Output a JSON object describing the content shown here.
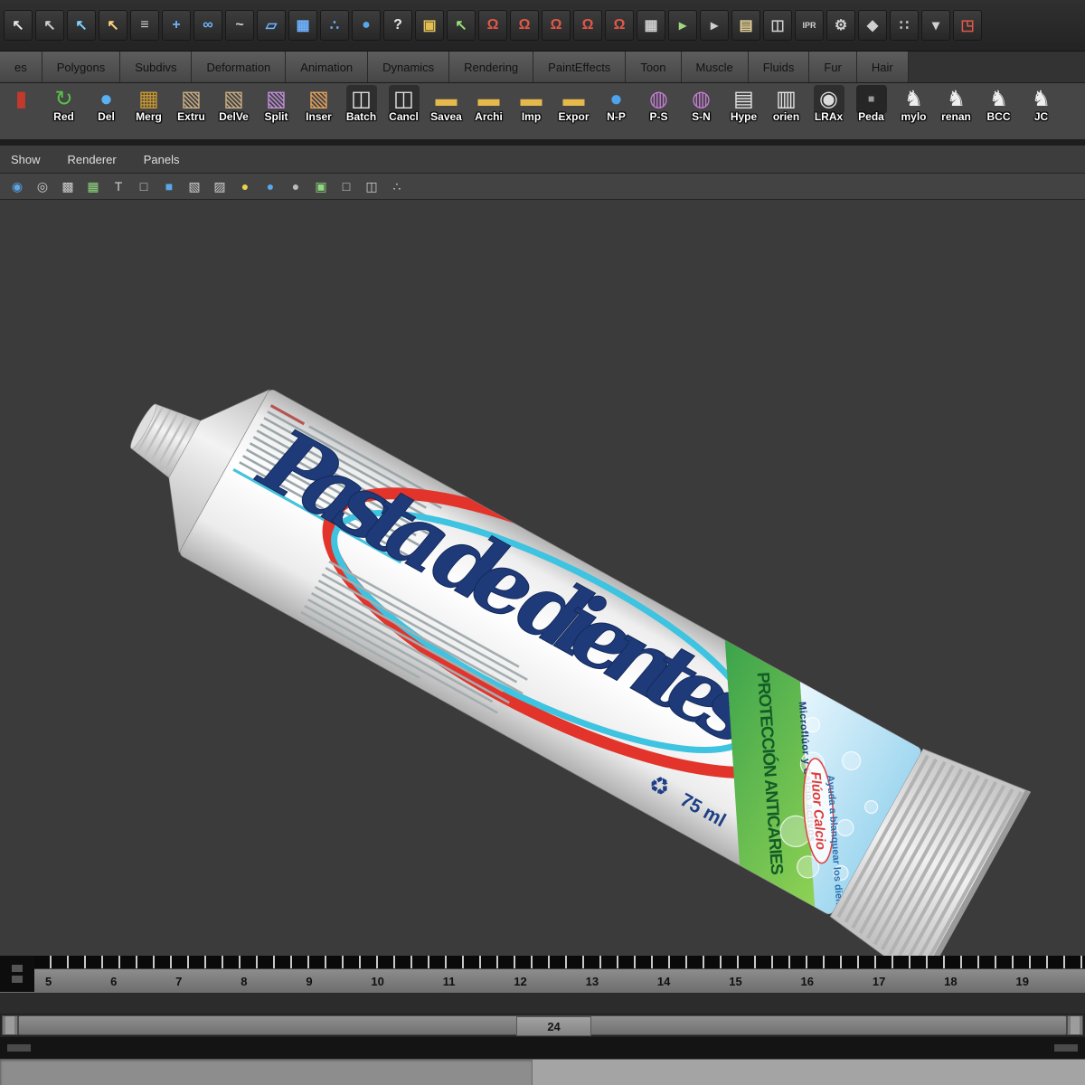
{
  "status_line": {
    "icons": [
      {
        "name": "select-tool-icon",
        "g": "↖",
        "c": "#e6e6e6"
      },
      {
        "name": "lasso-tool-icon",
        "g": "↖",
        "c": "#cfcfcf"
      },
      {
        "name": "paint-select-tool-icon",
        "g": "↖",
        "c": "#7fd4ff"
      },
      {
        "name": "select-mask-icon",
        "g": "↖",
        "c": "#ffd27f"
      },
      {
        "name": "snap-menu-icon",
        "g": "≡",
        "c": "#cfcfcf"
      },
      {
        "name": "move-tool-icon",
        "g": "+",
        "c": "#6fb3ff"
      },
      {
        "name": "rotate-tool-icon",
        "g": "∞",
        "c": "#6fb3ff"
      },
      {
        "name": "curve-target-icon",
        "g": "~",
        "c": "#cfcfcf"
      },
      {
        "name": "plane-target-icon",
        "g": "▱",
        "c": "#6fb3ff"
      },
      {
        "name": "lattice-target-icon",
        "g": "▦",
        "c": "#6fb3ff"
      },
      {
        "name": "points-target-icon",
        "g": "∴",
        "c": "#6fb3ff"
      },
      {
        "name": "sphere-target-icon",
        "g": "●",
        "c": "#5aa7e8"
      },
      {
        "name": "help-icon",
        "g": "?",
        "c": "#e8e8e8"
      },
      {
        "name": "lock-icon",
        "g": "▣",
        "c": "#e3bf54"
      },
      {
        "name": "selection-box-icon",
        "g": "↖",
        "c": "#97e07a"
      },
      {
        "name": "snap-to-grid-icon",
        "g": "Ω",
        "c": "#e0584a"
      },
      {
        "name": "snap-to-curve-icon",
        "g": "Ω",
        "c": "#e0584a"
      },
      {
        "name": "snap-to-point-icon",
        "g": "Ω",
        "c": "#e0584a"
      },
      {
        "name": "snap-to-projected-center-icon",
        "g": "Ω",
        "c": "#e0584a"
      },
      {
        "name": "snap-to-view-plane-icon",
        "g": "Ω",
        "c": "#e0584a"
      },
      {
        "name": "make-live-icon",
        "g": "▦",
        "c": "#cfcfcf"
      },
      {
        "name": "input-connections-icon",
        "g": "▸",
        "c": "#9fd87f"
      },
      {
        "name": "output-connections-icon",
        "g": "▸",
        "c": "#cfcfcf"
      },
      {
        "name": "construction-history-icon",
        "g": "▤",
        "c": "#e8d49a"
      },
      {
        "name": "render-view-icon",
        "g": "◫",
        "c": "#d0d0d0"
      },
      {
        "name": "ipr-render-icon",
        "g": "IPR",
        "c": "#d0d0d0",
        "fs": "9px"
      },
      {
        "name": "render-settings-icon",
        "g": "⚙",
        "c": "#d0d0d0"
      },
      {
        "name": "hypershade-icon",
        "g": "◆",
        "c": "#d0d0d0"
      },
      {
        "name": "display-layers-icon",
        "g": "∷",
        "c": "#d0d0d0"
      },
      {
        "name": "menu-arrow-icon",
        "g": "▾",
        "c": "#d0d0d0"
      },
      {
        "name": "workspace-icon",
        "g": "◳",
        "c": "#e0584a"
      }
    ]
  },
  "shelf_tabs": {
    "tabs": [
      "es",
      "Polygons",
      "Subdivs",
      "Deformation",
      "Animation",
      "Dynamics",
      "Rendering",
      "PaintEffects",
      "Toon",
      "Muscle",
      "Fluids",
      "Fur",
      "Hair"
    ]
  },
  "shelf": {
    "items": [
      {
        "name": "shelf-item-undo",
        "label": "",
        "g": "▮",
        "fg": "#c23a2e"
      },
      {
        "name": "shelf-item-redo",
        "label": "Red",
        "g": "↻",
        "fg": "#57c24a"
      },
      {
        "name": "shelf-item-del",
        "label": "Del",
        "g": "●",
        "fg": "#5ab0f0"
      },
      {
        "name": "shelf-item-merge",
        "label": "Merg",
        "g": "▦",
        "fg": "#c9972e"
      },
      {
        "name": "shelf-item-extrude",
        "label": "Extru",
        "g": "▧",
        "fg": "#cdb184"
      },
      {
        "name": "shelf-item-delvertex",
        "label": "DelVe",
        "g": "▧",
        "fg": "#cdb184"
      },
      {
        "name": "shelf-item-split",
        "label": "Split",
        "g": "▧",
        "fg": "#c78fe0"
      },
      {
        "name": "shelf-item-insert",
        "label": "Inser",
        "g": "▧",
        "fg": "#e8a45c"
      },
      {
        "name": "shelf-item-batch",
        "label": "Batch",
        "g": "◫",
        "fg": "#e6e6e6",
        "bg": "#2e2e2e"
      },
      {
        "name": "shelf-item-cancel",
        "label": "Cancl",
        "g": "◫",
        "fg": "#e6e6e6",
        "bg": "#2e2e2e"
      },
      {
        "name": "shelf-item-saveas",
        "label": "Savea",
        "g": "▬",
        "fg": "#e6b94d"
      },
      {
        "name": "shelf-item-archive",
        "label": "Archi",
        "g": "▬",
        "fg": "#e6b94d"
      },
      {
        "name": "shelf-item-import",
        "label": "Imp",
        "g": "▬",
        "fg": "#e6b94d"
      },
      {
        "name": "shelf-item-export",
        "label": "Expor",
        "g": "▬",
        "fg": "#e6b94d"
      },
      {
        "name": "shelf-item-n-p",
        "label": "N-P",
        "g": "●",
        "fg": "#4da3ec"
      },
      {
        "name": "shelf-item-p-s",
        "label": "P-S",
        "g": "◍",
        "fg": "#c77bd6"
      },
      {
        "name": "shelf-item-s-n",
        "label": "S-N",
        "g": "◍",
        "fg": "#c77bd6"
      },
      {
        "name": "shelf-item-hypershade",
        "label": "Hype",
        "g": "▤",
        "fg": "#e2e2e2"
      },
      {
        "name": "shelf-item-orient",
        "label": "orien",
        "g": "▥",
        "fg": "#e2e2e2"
      },
      {
        "name": "shelf-item-lraxis",
        "label": "LRAx",
        "g": "◉",
        "fg": "#dcdcdc",
        "bg": "#2e2e2e"
      },
      {
        "name": "shelf-item-pedal",
        "label": "Peda",
        "g": "▪",
        "fg": "#9a9a9a",
        "bg": "#262626"
      },
      {
        "name": "shelf-item-mylo",
        "label": "mylo",
        "g": "♞",
        "fg": "#eeeeee"
      },
      {
        "name": "shelf-item-rename",
        "label": "renan",
        "g": "♞",
        "fg": "#eeeeee"
      },
      {
        "name": "shelf-item-bcc",
        "label": "BCC",
        "g": "♞",
        "fg": "#eeeeee"
      },
      {
        "name": "shelf-item-jc",
        "label": "JC",
        "g": "♞",
        "fg": "#eeeeee"
      }
    ]
  },
  "panel_menu": {
    "items": [
      "Show",
      "Renderer",
      "Panels"
    ]
  },
  "viewport_toolbar": {
    "icons": [
      {
        "name": "lighting-icon",
        "g": "◉",
        "c": "#5aa7e8"
      },
      {
        "name": "shading-smooth-icon",
        "g": "◎",
        "c": "#cfcfcf"
      },
      {
        "name": "texture-view-icon",
        "g": "▩",
        "c": "#cfcfcf"
      },
      {
        "name": "grid-toggle-icon",
        "g": "▦",
        "c": "#8fd87f"
      },
      {
        "name": "film-gate-icon",
        "g": "T",
        "c": "#cfcfcf"
      },
      {
        "name": "wireframe-cube-icon",
        "g": "□",
        "c": "#cfcfcf"
      },
      {
        "name": "shaded-cube-icon",
        "g": "■",
        "c": "#5aa7e8"
      },
      {
        "name": "textured-cube-icon",
        "g": "▧",
        "c": "#cfcfcf"
      },
      {
        "name": "checker-cube-icon",
        "g": "▨",
        "c": "#cfcfcf"
      },
      {
        "name": "default-light-icon",
        "g": "●",
        "c": "#e8d44a"
      },
      {
        "name": "all-lights-icon",
        "g": "●",
        "c": "#5aa7e8"
      },
      {
        "name": "no-lights-icon",
        "g": "●",
        "c": "#bbbbbb"
      },
      {
        "name": "isolate-select-icon",
        "g": "▣",
        "c": "#8fd87f"
      },
      {
        "name": "single-pane-icon",
        "g": "□",
        "c": "#cfcfcf"
      },
      {
        "name": "multi-pane-icon",
        "g": "◫",
        "c": "#cfcfcf"
      },
      {
        "name": "share-view-icon",
        "g": "∴",
        "c": "#cfcfcf"
      }
    ]
  },
  "viewport": {
    "tube": {
      "brand": "Pasta de dientes",
      "band": "PROTECCIÓN ANTICARIES",
      "active": "Microflúor y Calcio activos",
      "badge": "Flúor Calcio",
      "claim": "Ayuda a blanquear los dientes",
      "volume": "75 ml",
      "recycle_icon": "♻"
    }
  },
  "time_slider": {
    "frames": [
      "5",
      "6",
      "7",
      "8",
      "9",
      "10",
      "11",
      "12",
      "13",
      "14",
      "15",
      "16",
      "17",
      "18",
      "19"
    ]
  },
  "range_slider": {
    "current_frame": "24"
  },
  "command_line": {
    "input": "",
    "help": ""
  }
}
